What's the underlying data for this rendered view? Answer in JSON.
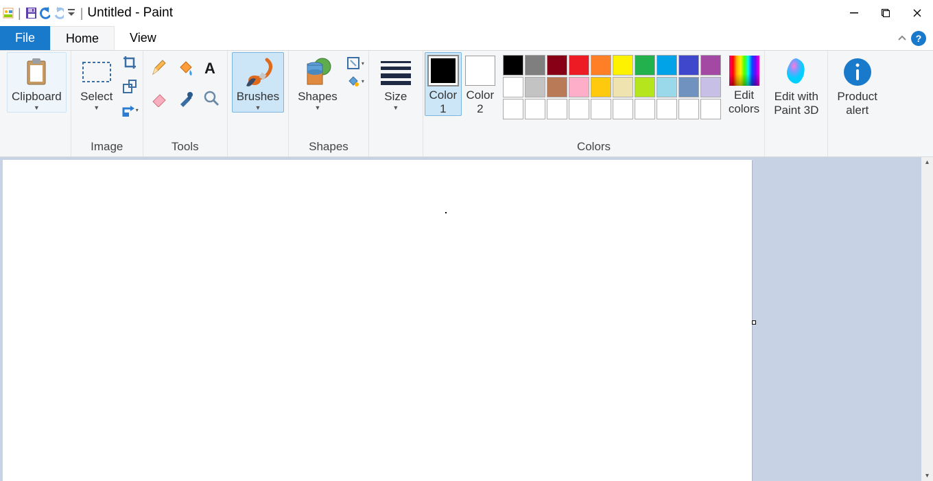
{
  "title": "Untitled - Paint",
  "tabs": {
    "file": "File",
    "home": "Home",
    "view": "View"
  },
  "ribbon": {
    "clipboard": {
      "label": "Clipboard"
    },
    "image": {
      "group": "Image",
      "select": "Select"
    },
    "tools": {
      "group": "Tools"
    },
    "brushes": {
      "label": "Brushes"
    },
    "shapes": {
      "label": "Shapes",
      "group": "Shapes"
    },
    "size": {
      "label": "Size"
    },
    "color1": {
      "label": "Color\n1"
    },
    "color2": {
      "label": "Color\n2"
    },
    "colors_group": "Colors",
    "edit_colors": "Edit\ncolors",
    "paint3d": "Edit with\nPaint 3D",
    "product_alert": "Product\nalert"
  },
  "palette": {
    "row1": [
      "#000000",
      "#7f7f7f",
      "#880015",
      "#ed1c24",
      "#ff7f27",
      "#fff200",
      "#22b14c",
      "#00a2e8",
      "#3f48cc",
      "#a349a4"
    ],
    "row2": [
      "#ffffff",
      "#c3c3c3",
      "#b97a57",
      "#ffaec9",
      "#ffc90e",
      "#efe4b0",
      "#b5e61d",
      "#99d9ea",
      "#7092be",
      "#c8bfe7"
    ],
    "row3": [
      "",
      "",
      "",
      "",
      "",
      "",
      "",
      "",
      "",
      ""
    ]
  }
}
